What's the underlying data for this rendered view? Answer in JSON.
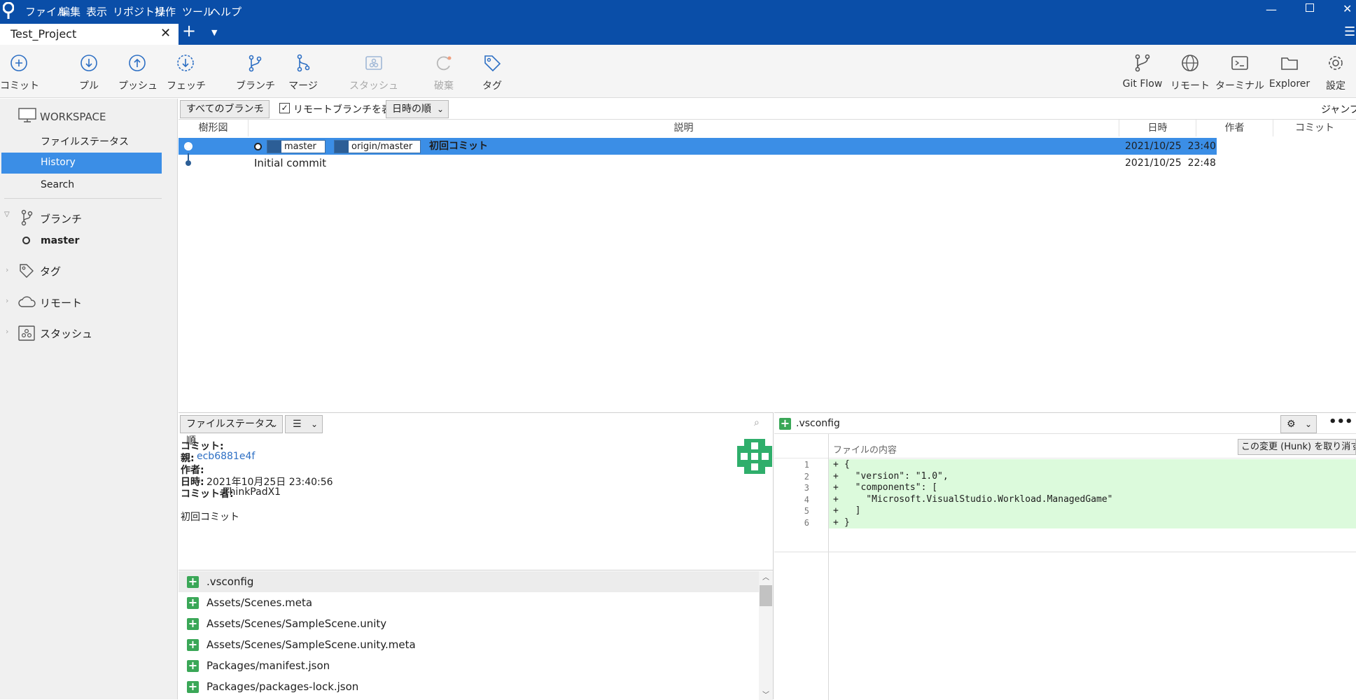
{
  "menu": [
    "ファイル",
    "編集",
    "表示",
    "リポジトリ",
    "操作",
    "ツール",
    "ヘルプ"
  ],
  "tab": {
    "title": "Test_Project"
  },
  "toolbar": {
    "commit": "コミット",
    "pull": "プル",
    "push": "プッシュ",
    "fetch": "フェッチ",
    "branch": "ブランチ",
    "merge": "マージ",
    "stash": "スタッシュ",
    "discard": "破棄",
    "tag": "タグ",
    "gitflow": "Git Flow",
    "remote": "リモート",
    "terminal": "ターミナル",
    "explorer": "Explorer",
    "settings": "設定"
  },
  "sidebar": {
    "workspace": "WORKSPACE",
    "file_status": "ファイルステータス",
    "history": "History",
    "search": "Search",
    "branches": "ブランチ",
    "branch_master": "master",
    "tags": "タグ",
    "remotes": "リモート",
    "stashes": "スタッシュ"
  },
  "filters": {
    "branch_filter": "すべてのブランチ",
    "show_remote": "リモートブランチを表示",
    "sort": "日時の順",
    "jump": "ジャンプ先"
  },
  "columns": {
    "graph": "樹形図",
    "description": "説明",
    "date": "日時",
    "author": "作者",
    "commit": "コミット"
  },
  "commits": [
    {
      "badge1": "master",
      "badge2": "origin/master",
      "message": "初回コミット",
      "date": "2021/10/25  23:40"
    },
    {
      "message": "Initial commit",
      "date": "2021/10/25  22:48"
    }
  ],
  "details": {
    "sort": "ファイルステータス順",
    "commit_label": "コミット:",
    "parent_label": "親:",
    "parent_hash": "ecb6881e4f",
    "author_label": "作者:",
    "date_label": "日時:",
    "date_value": "2021年10月25日 23:40:56",
    "committer_label": "コミット者:",
    "committer_value": "ThinkPadX1",
    "message": "初回コミット"
  },
  "files": [
    ".vsconfig",
    "Assets/Scenes.meta",
    "Assets/Scenes/SampleScene.unity",
    "Assets/Scenes/SampleScene.unity.meta",
    "Packages/manifest.json",
    "Packages/packages-lock.json"
  ],
  "diff": {
    "filename": ".vsconfig",
    "content_label": "ファイルの内容",
    "discard_hunk": "この変更 (Hunk) を取り消す",
    "lines": [
      {
        "n": "1",
        "text": "{"
      },
      {
        "n": "2",
        "text": "  \"version\": \"1.0\","
      },
      {
        "n": "3",
        "text": "  \"components\": ["
      },
      {
        "n": "4",
        "text": "    \"Microsoft.VisualStudio.Workload.ManagedGame\""
      },
      {
        "n": "5",
        "text": "  ]"
      },
      {
        "n": "6",
        "text": "}"
      }
    ]
  },
  "colors": {
    "accent": "#0a4ea8",
    "selection": "#3b8ee6",
    "added": "#dcfadc",
    "badge": "#2c5e96"
  }
}
